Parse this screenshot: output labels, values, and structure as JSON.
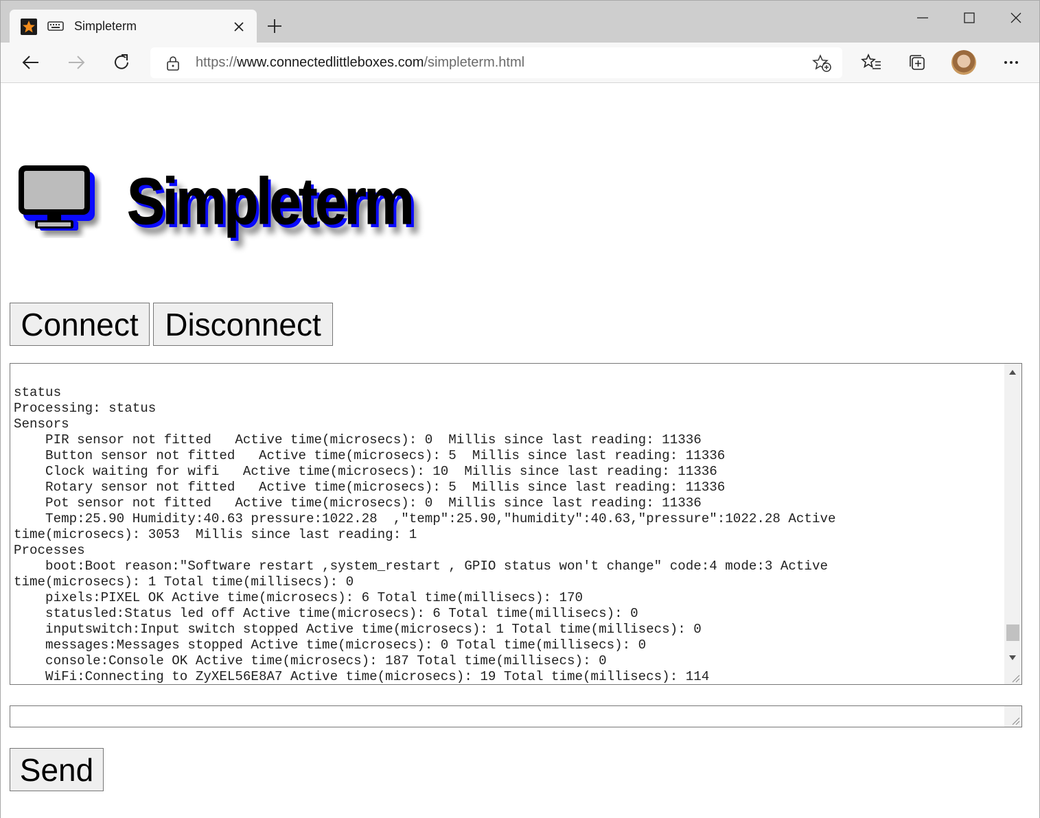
{
  "browser": {
    "tab": {
      "title": "Simpleterm"
    },
    "address": {
      "scheme": "https://",
      "host": "www.connectedlittleboxes.com",
      "path": "/simpleterm.html"
    },
    "icons": {
      "favicon": "star-favicon-icon",
      "tab_page_icon": "keyboard-icon",
      "close": "close-icon",
      "new_tab": "plus-icon",
      "back": "back-arrow-icon",
      "forward": "forward-arrow-icon",
      "refresh": "refresh-icon",
      "lock": "lock-icon",
      "add_favorite": "add-favorite-icon",
      "favorites": "favorites-icon",
      "collections": "collections-icon",
      "more": "more-icon"
    }
  },
  "page": {
    "logo_text": "Simpleterm",
    "connect_label": "Connect",
    "disconnect_label": "Disconnect",
    "send_label": "Send",
    "command_value": "",
    "console_lines": [
      "status",
      "Processing: status",
      "Sensors",
      "    PIR sensor not fitted   Active time(microsecs): 0  Millis since last reading: 11336",
      "    Button sensor not fitted   Active time(microsecs): 5  Millis since last reading: 11336",
      "    Clock waiting for wifi   Active time(microsecs): 10  Millis since last reading: 11336",
      "    Rotary sensor not fitted   Active time(microsecs): 5  Millis since last reading: 11336",
      "    Pot sensor not fitted   Active time(microsecs): 0  Millis since last reading: 11336",
      "    Temp:25.90 Humidity:40.63 pressure:1022.28  ,\"temp\":25.90,\"humidity\":40.63,\"pressure\":1022.28 Active",
      "time(microsecs): 3053  Millis since last reading: 1",
      "Processes",
      "    boot:Boot reason:\"Software restart ,system_restart , GPIO status won't change\" code:4 mode:3 Active",
      "time(microsecs): 1 Total time(millisecs): 0",
      "    pixels:PIXEL OK Active time(microsecs): 6 Total time(millisecs): 170",
      "    statusled:Status led off Active time(microsecs): 6 Total time(millisecs): 0",
      "    inputswitch:Input switch stopped Active time(microsecs): 1 Total time(millisecs): 0",
      "    messages:Messages stopped Active time(microsecs): 0 Total time(millisecs): 0",
      "    console:Console OK Active time(microsecs): 187 Total time(millisecs): 0",
      "    WiFi:Connecting to ZyXEL56E8A7 Active time(microsecs): 19 Total time(millisecs): 114"
    ],
    "icons": {
      "logo": "monitor-icon"
    }
  }
}
